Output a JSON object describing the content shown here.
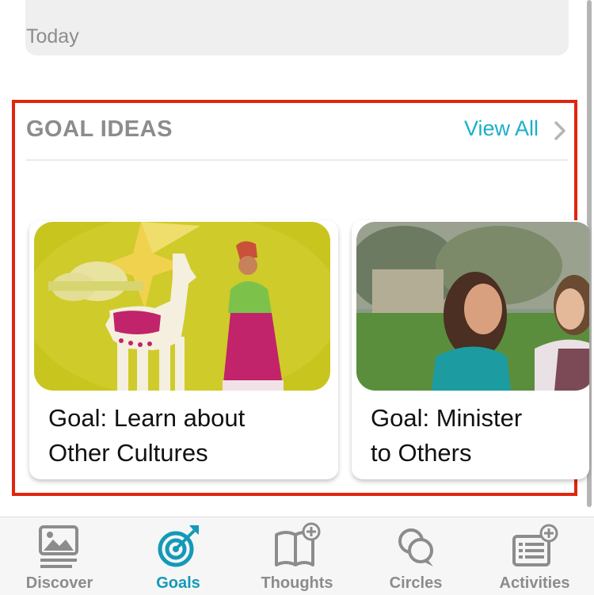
{
  "today": {
    "label": "Today"
  },
  "goal_ideas": {
    "title": "GOAL IDEAS",
    "view_all_label": "View All",
    "cards": [
      {
        "title_line1": "Goal: Learn about",
        "title_line2": "Other Cultures",
        "image": "llama-illustration"
      },
      {
        "title_line1": "Goal: Minister",
        "title_line2": "to Others",
        "image": "photo-two-young-women"
      }
    ]
  },
  "tabbar": {
    "tabs": [
      {
        "label": "Discover",
        "icon": "picture-icon",
        "active": false
      },
      {
        "label": "Goals",
        "icon": "target-icon",
        "active": true
      },
      {
        "label": "Thoughts",
        "icon": "book-plus-icon",
        "active": false
      },
      {
        "label": "Circles",
        "icon": "chat-bubbles-icon",
        "active": false
      },
      {
        "label": "Activities",
        "icon": "list-plus-icon",
        "active": false
      }
    ],
    "active_color": "#1499b8",
    "inactive_color": "#8c8c8c"
  },
  "colors": {
    "accent": "#1aafc9",
    "highlight_border": "#e0260f"
  }
}
